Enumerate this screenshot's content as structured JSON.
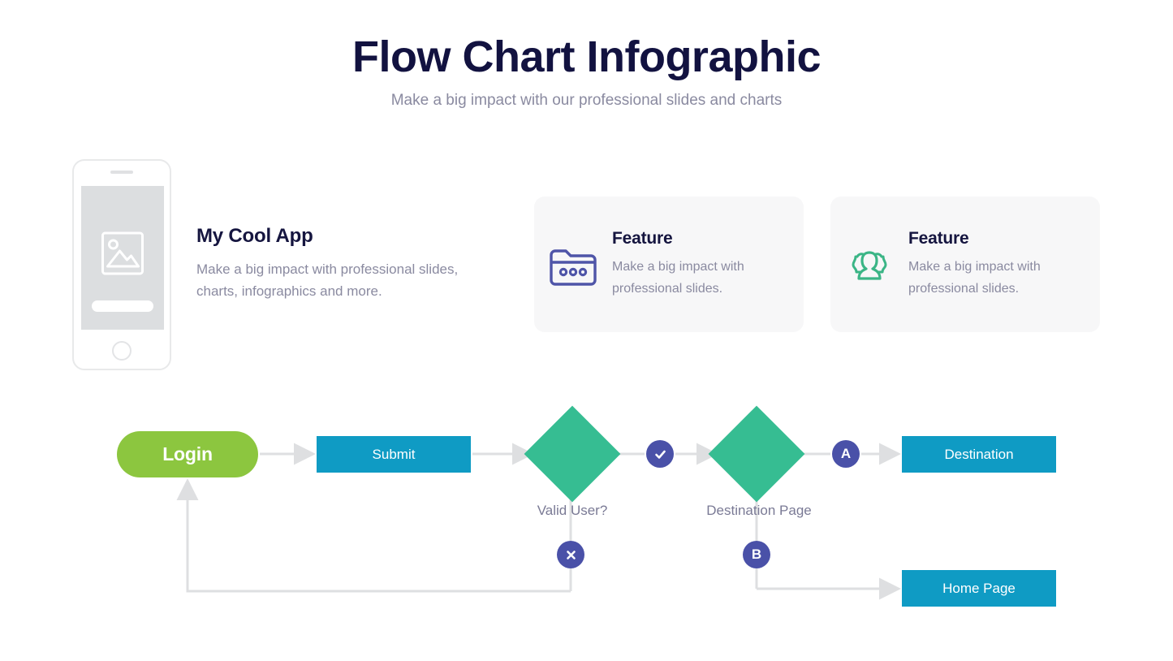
{
  "header": {
    "title": "Flow Chart Infographic",
    "subtitle": "Make a big impact with our professional slides and charts"
  },
  "intro": {
    "title": "My Cool App",
    "body": "Make a big impact with professional slides, charts, infographics and more.",
    "phone_icon": "image-placeholder-icon"
  },
  "cards": [
    {
      "icon": "folder-icon",
      "icon_color": "#4f55a8",
      "title": "Feature",
      "body": "Make a big impact with professional slides."
    },
    {
      "icon": "users-icon",
      "icon_color": "#3bb586",
      "title": "Feature",
      "body": "Make a big impact with professional slides."
    }
  ],
  "flowchart": {
    "nodes": {
      "login": "Login",
      "submit": "Submit",
      "destination": "Destination",
      "home_page": "Home Page"
    },
    "decisions": {
      "valid_user": "Valid User?",
      "destination_page": "Destination Page"
    },
    "badges": {
      "check": "check-icon",
      "a": "A",
      "x": "close-icon",
      "b": "B"
    }
  },
  "colors": {
    "title": "#121240",
    "muted": "#8a8aa0",
    "green_pill": "#8cc63f",
    "blue_box": "#0f9bc4",
    "teal_diamond": "#36bd92",
    "indigo_badge": "#4a51a8",
    "card_bg": "#f7f7f8",
    "connector": "#dedfe1"
  }
}
